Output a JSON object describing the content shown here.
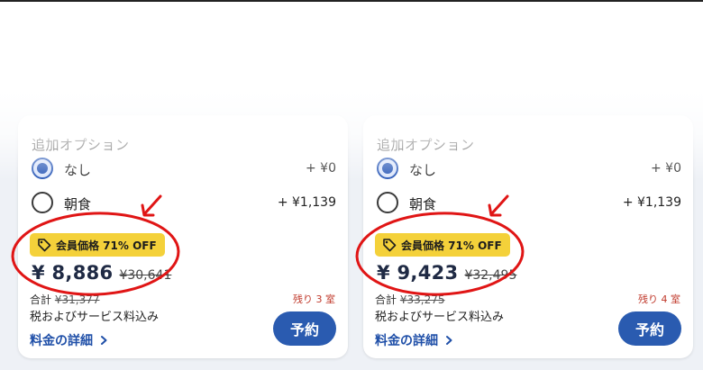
{
  "cards": [
    {
      "options_title": "追加オプション",
      "options": [
        {
          "label": "なし",
          "price": "+ ¥0",
          "selected": true
        },
        {
          "label": "朝食",
          "price": "+ ¥1,139",
          "selected": false
        }
      ],
      "badge": "会員価格 71% OFF",
      "price": "¥ 8,886",
      "original_price": "¥30,641",
      "total_label": "合計",
      "total_value": "¥31,377",
      "rooms_left": "残り 3 室",
      "tax_note": "税およびサービス料込み",
      "details_link": "料金の詳細",
      "book_button": "予約"
    },
    {
      "options_title": "追加オプション",
      "options": [
        {
          "label": "なし",
          "price": "+ ¥0",
          "selected": true
        },
        {
          "label": "朝食",
          "price": "+ ¥1,139",
          "selected": false
        }
      ],
      "badge": "会員価格 71% OFF",
      "price": "¥ 9,423",
      "original_price": "¥32,495",
      "total_label": "合計",
      "total_value": "¥33,275",
      "rooms_left": "残り 4 室",
      "tax_note": "税およびサービス料込み",
      "details_link": "料金の詳細",
      "book_button": "予約"
    }
  ],
  "colors": {
    "badge": "#f4d13a",
    "primary": "#2a5bb0",
    "rooms_left": "#c0392b",
    "annotation": "#e01515"
  },
  "icons": [
    "price-tag-icon",
    "chevron-right-icon",
    "annotation-arrow"
  ]
}
